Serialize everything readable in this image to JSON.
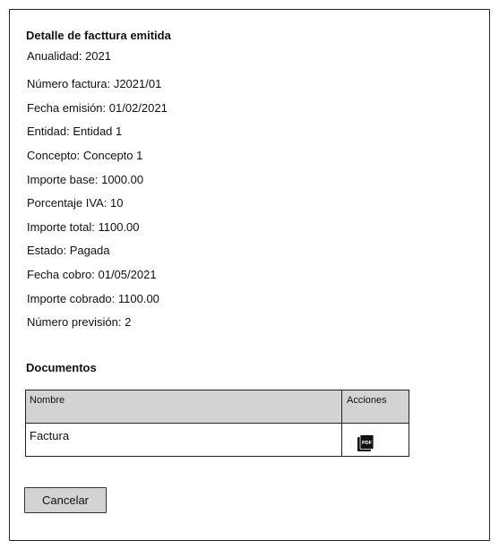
{
  "detail": {
    "title": "Detalle de facttura emitida",
    "fields": [
      "Anualidad: 2021",
      "Número factura: J2021/01",
      "Fecha emisión: 01/02/2021",
      "Entidad: Entidad 1",
      "Concepto: Concepto 1",
      "Importe base: 1000.00",
      "Porcentaje IVA: 10",
      "Importe total: 1100.00",
      "Estado: Pagada",
      "Fecha cobro: 01/05/2021",
      "Importe cobrado: 1100.00",
      "Número previsión: 2"
    ]
  },
  "documents": {
    "title": "Documentos",
    "columns": [
      "Nombre",
      "Acciones"
    ],
    "rows": [
      {
        "name": "Factura",
        "action_icon": "pdf-icon",
        "icon_text": "PDF"
      }
    ]
  },
  "actions": {
    "cancel_label": "Cancelar"
  }
}
